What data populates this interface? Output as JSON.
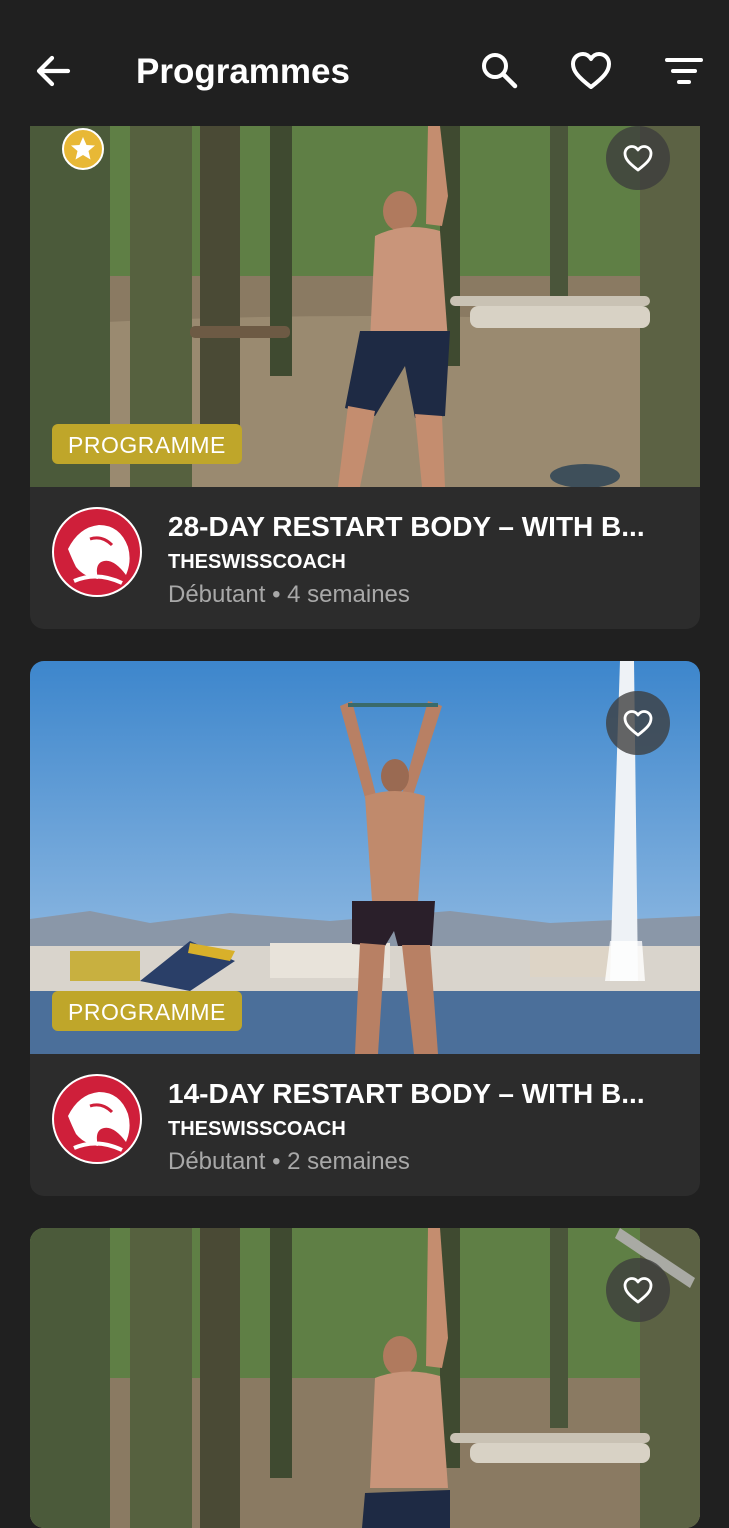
{
  "header": {
    "title": "Programmes",
    "back_icon": "arrow-left-icon",
    "search_icon": "search-icon",
    "favorites_icon": "heart-outline-icon",
    "filter_icon": "filter-icon"
  },
  "programs": [
    {
      "tag": "PROGRAMME",
      "title": "28-DAY RESTART BODY – WITH B...",
      "coach": "THESWISSCOACH",
      "level": "Débutant",
      "separator": "•",
      "duration": "4 semaines",
      "featured": true
    },
    {
      "tag": "PROGRAMME",
      "title": "14-DAY RESTART BODY – WITH B...",
      "coach": "THESWISSCOACH",
      "level": "Débutant",
      "separator": "•",
      "duration": "2 semaines",
      "featured": false
    }
  ],
  "colors": {
    "background": "#202020",
    "card": "#2c2c2c",
    "tag": "#bfa62a",
    "avatar": "#cf1f3a",
    "star": "#e8b836",
    "meta_text": "#a8a8a8"
  }
}
